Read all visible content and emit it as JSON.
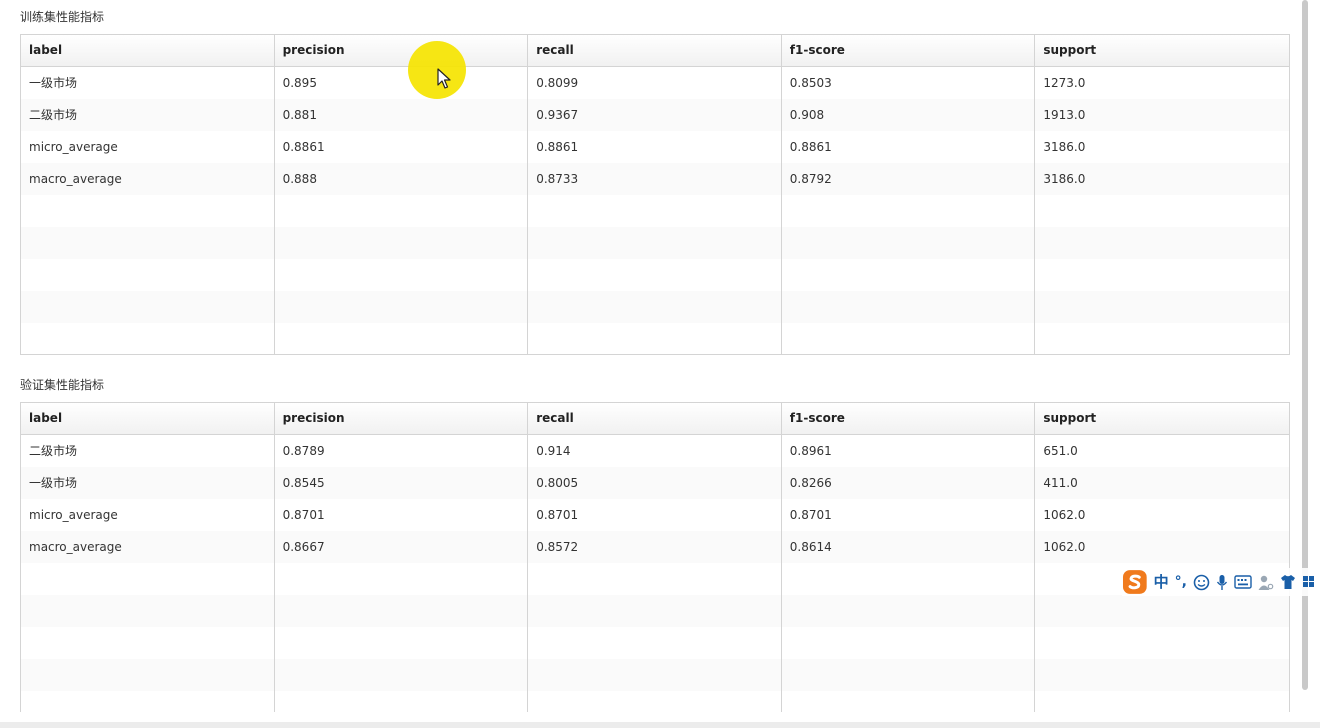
{
  "sections": [
    {
      "title": "训练集性能指标",
      "columns": [
        "label",
        "precision",
        "recall",
        "f1-score",
        "support"
      ],
      "rows": [
        [
          "一级市场",
          "0.895",
          "0.8099",
          "0.8503",
          "1273.0"
        ],
        [
          "二级市场",
          "0.881",
          "0.9367",
          "0.908",
          "1913.0"
        ],
        [
          "micro_average",
          "0.8861",
          "0.8861",
          "0.8861",
          "3186.0"
        ],
        [
          "macro_average",
          "0.888",
          "0.8733",
          "0.8792",
          "3186.0"
        ]
      ]
    },
    {
      "title": "验证集性能指标",
      "columns": [
        "label",
        "precision",
        "recall",
        "f1-score",
        "support"
      ],
      "rows": [
        [
          "二级市场",
          "0.8789",
          "0.914",
          "0.8961",
          "651.0"
        ],
        [
          "一级市场",
          "0.8545",
          "0.8005",
          "0.8266",
          "411.0"
        ],
        [
          "micro_average",
          "0.8701",
          "0.8701",
          "0.8701",
          "1062.0"
        ],
        [
          "macro_average",
          "0.8667",
          "0.8572",
          "0.8614",
          "1062.0"
        ]
      ]
    }
  ],
  "ime_toolbar": {
    "logo_icon": "sogou-s-icon",
    "mode_label": "中",
    "punct_label": "°,",
    "icons": [
      "emoji-icon",
      "microphone-icon",
      "keyboard-icon",
      "user-icon",
      "shirt-icon",
      "grid-icon"
    ]
  },
  "colors": {
    "cursor_highlight": "#f5e400",
    "ime_accent": "#1a5fa8",
    "ime_logo": "#f07a1c",
    "grid_border": "#d4d4d4"
  }
}
